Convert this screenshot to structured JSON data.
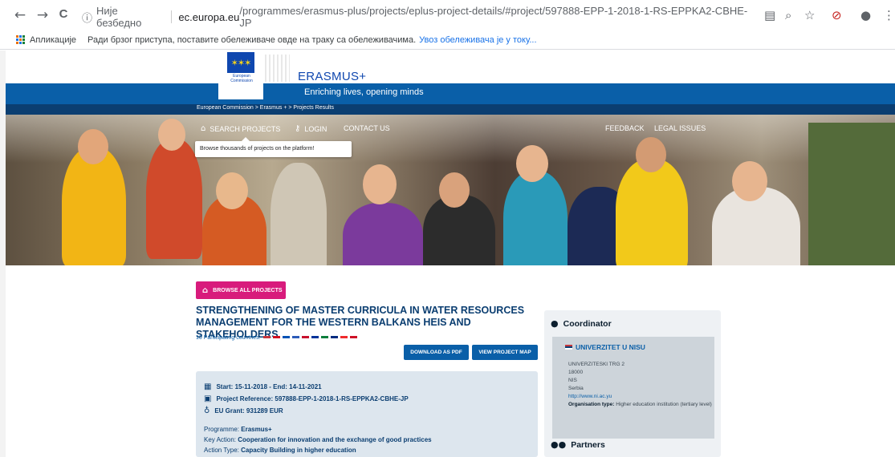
{
  "browser": {
    "nav_back": "←",
    "nav_forward": "→",
    "nav_reload": "C",
    "security_label": "Није безбедно",
    "url_host": "ec.europa.eu",
    "url_path": "/programmes/erasmus-plus/projects/eplus-project-details/#project/597888-EPP-1-2018-1-RS-EPPKA2-CBHE-JP",
    "bookmarks_apps": "Апликације",
    "bookmarks_hint": "Ради брзог приступа, поставите обележиваче овде на траку са обележивачима.",
    "bookmarks_import": "Увоз обележивача је у току..."
  },
  "header": {
    "ec_logo_text": "European Commission",
    "site_title": "ERASMUS+",
    "tagline": "Enriching lives, opening minds",
    "breadcrumb": "European Commission > Erasmus + > Projects Results"
  },
  "nav": {
    "search": "SEARCH PROJECTS",
    "login": "LOGIN",
    "contact": "CONTACT US",
    "feedback": "FEEDBACK",
    "legal": "LEGAL ISSUES",
    "tooltip": "Browse thousands of projects on the platform!"
  },
  "project": {
    "browse_btn": "BROWSE ALL PROJECTS",
    "title": "STRENGTHENING OF MASTER CURRICULA IN WATER RESOURCES MANAGEMENT FOR THE WESTERN BALKANS HEIS AND STAKEHOLDERS",
    "countries_label": "10 Participating countries:",
    "country_flag_colors": [
      "#c6363c",
      "#d10f1f",
      "#0052b4",
      "#2d5bb8",
      "#c8102e",
      "#003399",
      "#0c7e3c",
      "#002b7f",
      "#ef2b2d",
      "#ce1126"
    ],
    "download_btn": "DOWNLOAD AS PDF",
    "map_btn": "VIEW PROJECT MAP",
    "dates": "Start: 15-11-2018 - End: 14-11-2021",
    "reference": "Project Reference: 597888-EPP-1-2018-1-RS-EPPKA2-CBHE-JP",
    "grant": "EU Grant: 931289 EUR",
    "programme_label": "Programme:",
    "programme": "Erasmus+",
    "key_action_label": "Key Action:",
    "key_action": "Cooperation for innovation and the exchange of good practices",
    "action_type_label": "Action Type:",
    "action_type": "Capacity Building in higher education"
  },
  "coordinator": {
    "heading": "Coordinator",
    "name": "UNIVERZITET U NISU",
    "address": "UNIVERZITESKI TRG 2",
    "postcode": "18000",
    "city": "NIS",
    "country": "Serbia",
    "url": "http://www.ni.ac.yu",
    "org_type_label": "Organisation type:",
    "org_type": "Higher education institution (tertiary level)",
    "partners_heading": "Partners"
  }
}
